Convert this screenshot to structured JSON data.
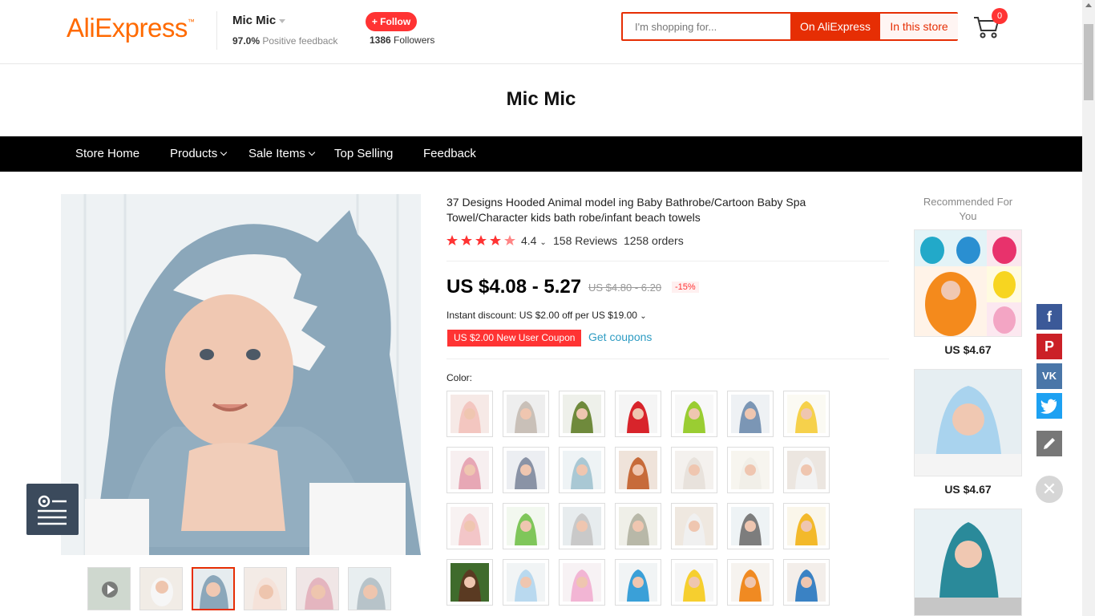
{
  "header": {
    "logo": "AliExpress",
    "store_name": "Mic Mic",
    "feedback_pct": "97.0%",
    "feedback_label": "Positive feedback",
    "follow_label": "+ Follow",
    "followers_count": "1386",
    "followers_label": "Followers",
    "search_placeholder": "I'm shopping for...",
    "search_btn_ali": "On AliExpress",
    "search_btn_store": "In this store",
    "cart_count": "0"
  },
  "store": {
    "title": "Mic Mic",
    "nav": [
      {
        "label": "Store Home"
      },
      {
        "label": "Products"
      },
      {
        "label": "Sale Items"
      },
      {
        "label": "Top Selling"
      },
      {
        "label": "Feedback"
      }
    ]
  },
  "product": {
    "title": "37 Designs Hooded Animal model ing Baby Bathrobe/Cartoon Baby Spa Towel/Character kids bath robe/infant beach towels",
    "rating": "4.4",
    "reviews": "158 Reviews",
    "orders": "1258 orders",
    "price": "US $4.08 - 5.27",
    "old_price": "US $4.80 - 6.20",
    "discount": "-15%",
    "instant_discount": "Instant discount: US $2.00 off per US $19.00",
    "coupon": "US $2.00 New User Coupon",
    "get_coupons": "Get coupons",
    "color_label": "Color:"
  },
  "recommended": {
    "title": "Recommended For You",
    "items": [
      {
        "price": "US $4.67"
      },
      {
        "price": "US $4.67"
      },
      {
        "price": ""
      }
    ]
  },
  "colors": {
    "accent": "#e62e04",
    "brand_orange": "#ff6a00",
    "nav_bg": "#000000",
    "link": "#2e9cc3"
  }
}
